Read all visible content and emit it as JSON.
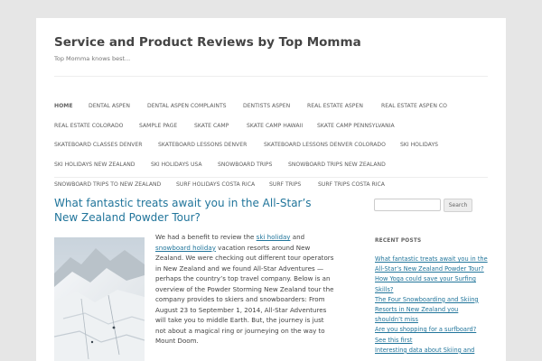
{
  "site": {
    "title": "Service and Product Reviews by Top Momma",
    "tagline": "Top Momma knows best..."
  },
  "nav": {
    "items": [
      {
        "label": "HOME",
        "current": true
      },
      {
        "label": "DENTAL ASPEN"
      },
      {
        "label": "DENTAL ASPEN COMPLAINTS"
      },
      {
        "label": "DENTISTS ASPEN"
      },
      {
        "label": "REAL ESTATE ASPEN"
      },
      {
        "label": "REAL ESTATE ASPEN CO"
      },
      {
        "label": "REAL ESTATE COLORADO"
      },
      {
        "label": "SAMPLE PAGE"
      },
      {
        "label": "SKATE CAMP"
      },
      {
        "label": "SKATE CAMP HAWAII"
      },
      {
        "label": "SKATE CAMP PENNSYLVANIA"
      },
      {
        "label": "SKATEBOARD CLASSES DENVER"
      },
      {
        "label": "SKATEBOARD LESSONS DENVER"
      },
      {
        "label": "SKATEBOARD LESSONS DENVER COLORADO"
      },
      {
        "label": "SKI HOLIDAYS"
      },
      {
        "label": "SKI HOLIDAYS NEW ZEALAND"
      },
      {
        "label": "SKI HOLIDAYS USA"
      },
      {
        "label": "SNOWBOARD TRIPS"
      },
      {
        "label": "SNOWBOARD TRIPS NEW ZEALAND"
      },
      {
        "label": "SNOWBOARD TRIPS TO NEW ZEALAND"
      },
      {
        "label": "SURF HOLIDAYS COSTA RICA"
      },
      {
        "label": "SURF TRIPS"
      },
      {
        "label": "SURF TRIPS COSTA RICA"
      }
    ]
  },
  "post": {
    "title": "What fantastic treats await you in the All-Star’s New Zealand Powder Tour?",
    "excerpt": {
      "part1": "We had a benefit to review the ",
      "link1": "ski holiday",
      "part2": " and ",
      "link2": "snowboard holiday",
      "part3": " vacation resorts around New Zealand. We were checking out different tour operators in New Zealand and we found All-Star Adventures — perhaps the country’s top travel company. Below is an overview of the Powder Storming New Zealand tour the company provides to skiers and snowboarders: From August 23 to September 1, 2014, All-Star Adventures will take you to middle Earth. But, the journey is just not about a magical ring or journeying on the way to Mount Doom."
    }
  },
  "sidebar": {
    "search_placeholder": "",
    "search_button": "Search",
    "recent_title": "RECENT POSTS",
    "recent_posts": [
      "What fantastic treats await you in the All-Star’s New Zealand Powder Tour?",
      "How Yoga could save your Surfing Skills?",
      "The Four Snowboarding and Skiing Resorts in New Zealand you shouldn’t miss",
      "Are you shopping for a surfboard? See this first",
      "Interesting data about Skiing and"
    ]
  },
  "colors": {
    "link": "#21759b",
    "background": "#e6e6e6",
    "page": "#ffffff"
  }
}
